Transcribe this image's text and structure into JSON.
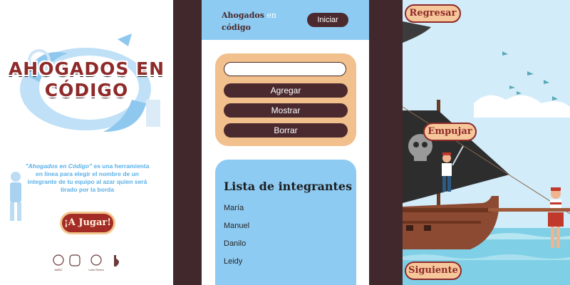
{
  "landing": {
    "logo_line1": "AHOGADOS EN",
    "logo_line2": "CÓDIGO",
    "description_italic": "\"Ahogados en Código\"",
    "description_rest": " es una herramienta en línea para elegir el nombre de un integrante de tu equipo al azar quien será tirado por la borda",
    "play_label": "¡A Jugar!",
    "sponsor_labels": [
      "AMBC",
      "",
      "Lado Rivera",
      ""
    ]
  },
  "manager": {
    "brand_part1": "Ahogados",
    "brand_part2": " en",
    "brand_part3": "código",
    "start_label": "Iniciar",
    "input_value": "",
    "input_placeholder": "",
    "add_label": "Agregar",
    "show_label": "Mostrar",
    "clear_label": "Borrar",
    "list_title": "Lista de integrantes",
    "members": [
      "María",
      "Manuel",
      "Danilo",
      "Leidy"
    ]
  },
  "game": {
    "back_label": "Regresar",
    "push_label": "Empujar",
    "next_label": "Siguiente"
  },
  "colors": {
    "frame": "#41282c",
    "sky_blue": "#8ecbf3",
    "sand": "#f1c08c",
    "brown": "#4b2a2f",
    "pirate_red": "#8e2a2a"
  }
}
